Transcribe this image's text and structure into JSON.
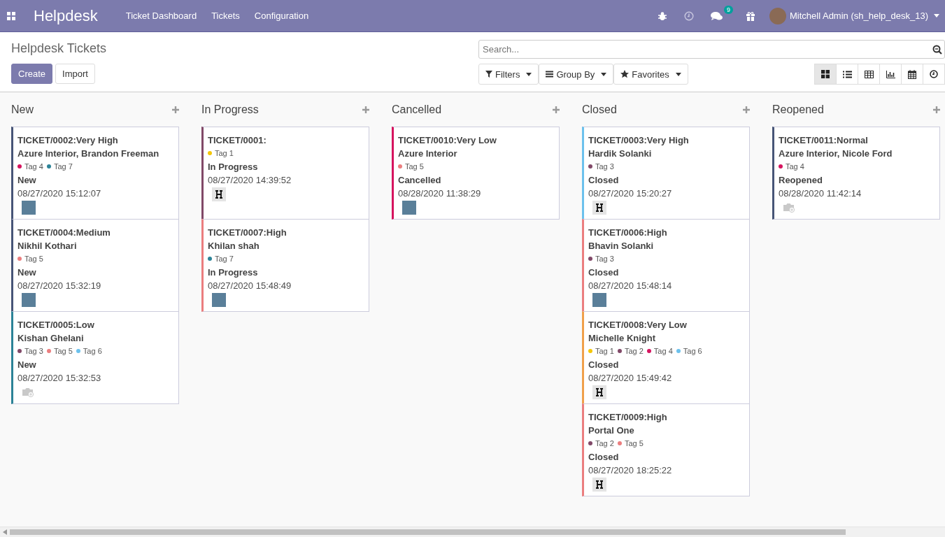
{
  "navbar": {
    "app_name": "Helpdesk",
    "menu": [
      "Ticket Dashboard",
      "Tickets",
      "Configuration"
    ],
    "chat_badge": "9",
    "user": "Mitchell Admin (sh_help_desk_13)"
  },
  "control_panel": {
    "title": "Helpdesk Tickets",
    "buttons": [
      "Create",
      "Import"
    ],
    "search": {
      "placeholder": "Search..."
    },
    "filters": [
      {
        "label": "Filters",
        "kind": "filter"
      },
      {
        "label": "Group By",
        "kind": "group"
      },
      {
        "label": "Favorites",
        "kind": "star"
      }
    ],
    "views": [
      {
        "kind": "kanban",
        "selected": true
      },
      {
        "kind": "list",
        "selected": false
      },
      {
        "kind": "pivot",
        "selected": false
      },
      {
        "kind": "graph",
        "selected": false
      },
      {
        "kind": "calendar",
        "selected": false
      },
      {
        "kind": "activity",
        "selected": false
      }
    ]
  },
  "columns": [
    {
      "title": "New",
      "cards": [
        {
          "ticket": "TICKET/0002:Very High",
          "partner": "Azure Interior, Brandon Freeman",
          "color": "#475577",
          "tags": [
            {
              "label": "Tag 4",
              "color": "#d6145f"
            },
            {
              "label": "Tag 7",
              "color": "#2c8397"
            }
          ],
          "stage": "New",
          "date": "08/27/2020 15:12:07",
          "avatar": {
            "kind": "photo"
          }
        },
        {
          "ticket": "TICKET/0004:Medium",
          "partner": "Nikhil Kothari",
          "color": "#475577",
          "tags": [
            {
              "label": "Tag 5",
              "color": "#eb7e7f"
            }
          ],
          "stage": "New",
          "date": "08/27/2020 15:32:19",
          "avatar": {
            "kind": "photo"
          }
        },
        {
          "ticket": "TICKET/0005:Low",
          "partner": "Kishan Ghelani",
          "color": "#2c8397",
          "tags": [
            {
              "label": "Tag 3",
              "color": "#814968"
            },
            {
              "label": "Tag 5",
              "color": "#eb7e7f"
            },
            {
              "label": "Tag 6",
              "color": "#6cc1ed"
            }
          ],
          "stage": "New",
          "date": "08/27/2020 15:32:53",
          "avatar": {
            "kind": "none"
          }
        }
      ]
    },
    {
      "title": "In Progress",
      "cards": [
        {
          "ticket": "TICKET/0001:",
          "color": "#814968",
          "tags": [
            {
              "label": "Tag 1",
              "color": "#f4c609"
            }
          ],
          "stage": "In Progress",
          "date": "08/27/2020 14:39:52",
          "avatar": {
            "kind": "logo"
          }
        },
        {
          "ticket": "TICKET/0007:High",
          "partner": "Khilan shah",
          "color": "#eb7e7f",
          "tags": [
            {
              "label": "Tag 7",
              "color": "#2c8397"
            }
          ],
          "stage": "In Progress",
          "date": "08/27/2020 15:48:49",
          "avatar": {
            "kind": "photo"
          }
        }
      ]
    },
    {
      "title": "Cancelled",
      "cards": [
        {
          "ticket": "TICKET/0010:Very Low",
          "partner": "Azure Interior",
          "color": "#d6145f",
          "tags": [
            {
              "label": "Tag 5",
              "color": "#eb7e7f"
            }
          ],
          "stage": "Cancelled",
          "date": "08/28/2020 11:38:29",
          "avatar": {
            "kind": "photo"
          }
        }
      ]
    },
    {
      "title": "Closed",
      "cards": [
        {
          "ticket": "TICKET/0003:Very High",
          "partner": "Hardik Solanki",
          "color": "#6cc1ed",
          "tags": [
            {
              "label": "Tag 3",
              "color": "#814968"
            }
          ],
          "stage": "Closed",
          "date": "08/27/2020 15:20:27",
          "avatar": {
            "kind": "logo"
          }
        },
        {
          "ticket": "TICKET/0006:High",
          "partner": "Bhavin Solanki",
          "color": "#eb7e7f",
          "tags": [
            {
              "label": "Tag 3",
              "color": "#814968"
            }
          ],
          "stage": "Closed",
          "date": "08/27/2020 15:48:14",
          "avatar": {
            "kind": "photo"
          }
        },
        {
          "ticket": "TICKET/0008:Very Low",
          "partner": "Michelle Knight",
          "color": "#f0a04b",
          "tags": [
            {
              "label": "Tag 1",
              "color": "#f4c609"
            },
            {
              "label": "Tag 2",
              "color": "#814968"
            },
            {
              "label": "Tag 4",
              "color": "#d6145f"
            },
            {
              "label": "Tag 6",
              "color": "#6cc1ed"
            }
          ],
          "stage": "Closed",
          "date": "08/27/2020 15:49:42",
          "avatar": {
            "kind": "logo"
          }
        },
        {
          "ticket": "TICKET/0009:High",
          "partner": "Portal One",
          "color": "#eb7e7f",
          "tags": [
            {
              "label": "Tag 2",
              "color": "#814968"
            },
            {
              "label": "Tag 5",
              "color": "#eb7e7f"
            }
          ],
          "stage": "Closed",
          "date": "08/27/2020 18:25:22",
          "avatar": {
            "kind": "logo"
          }
        }
      ]
    },
    {
      "title": "Reopened",
      "cards": [
        {
          "ticket": "TICKET/0011:Normal",
          "partner": "Azure Interior, Nicole Ford",
          "color": "#475577",
          "tags": [
            {
              "label": "Tag 4",
              "color": "#d6145f"
            }
          ],
          "stage": "Reopened",
          "date": "08/28/2020 11:42:14",
          "avatar": {
            "kind": "none"
          }
        }
      ]
    }
  ]
}
